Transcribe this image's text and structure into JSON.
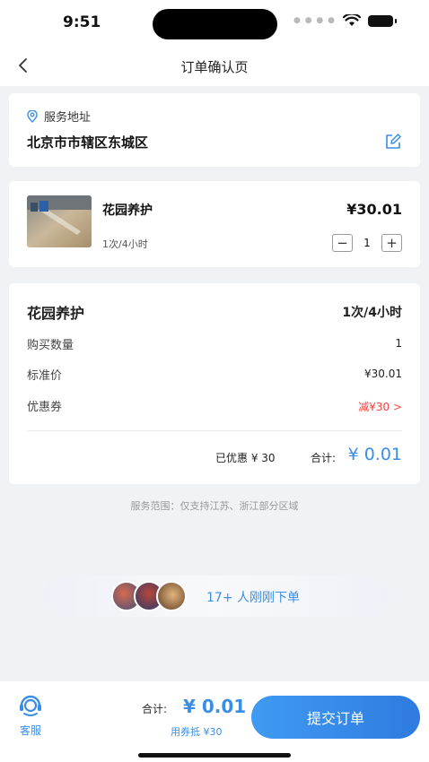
{
  "status_bar": {
    "time": "9:51"
  },
  "nav": {
    "title": "订单确认页"
  },
  "address": {
    "label": "服务地址",
    "value": "北京市市辖区东城区"
  },
  "product": {
    "name": "花园养护",
    "spec": "1次/4小时",
    "price": "¥30.01",
    "quantity": "1",
    "minus": "−",
    "plus": "+"
  },
  "summary": {
    "title": "花园养护",
    "title_right": "1次/4小时",
    "rows": [
      {
        "label": "购买数量",
        "value": "1"
      },
      {
        "label": "标准价",
        "value": "¥30.01"
      },
      {
        "label": "优惠券",
        "value": "减¥30 >"
      }
    ],
    "saved": "已优惠 ¥ 30",
    "total_label": "合计:",
    "total_amount": "¥ 0.01"
  },
  "service_range": "服务范围：仅支持江苏、浙江部分区域",
  "recent_buyers": "17+ 人刚刚下单",
  "bottom_bar": {
    "cs_label": "客服",
    "total_label": "合计:",
    "total_amount": "¥ 0.01",
    "coupon_note": "用券抵 ¥30",
    "submit_label": "提交订单"
  },
  "colors": {
    "accent": "#3a8ee6",
    "discount": "#f2453d"
  },
  "icons": [
    "back-icon",
    "location-icon",
    "edit-icon",
    "minus-icon",
    "plus-icon",
    "customer-service-icon",
    "wifi-icon",
    "battery-icon"
  ]
}
